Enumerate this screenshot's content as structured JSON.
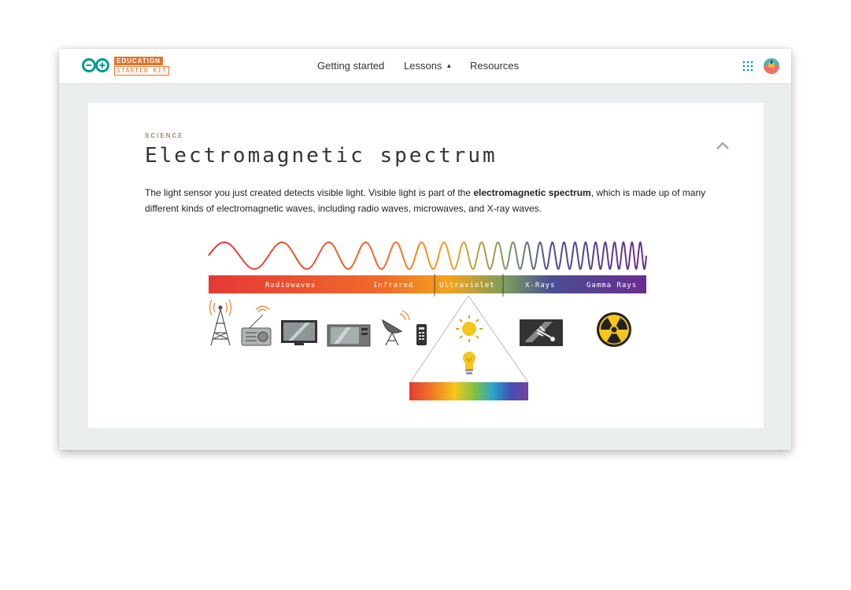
{
  "logo": {
    "tag_top": "EDUCATION",
    "tag_bottom": "STARTER KIT",
    "brand_color": "#e2732c",
    "mark_color": "#00979c"
  },
  "nav": {
    "items": [
      {
        "label": "Getting started"
      },
      {
        "label": "Lessons",
        "caret": "▲"
      },
      {
        "label": "Resources"
      }
    ]
  },
  "icons": {
    "apps": "grid-icon",
    "user": "avatar",
    "collapse": "chevron-up-icon"
  },
  "lesson": {
    "category": "SCIENCE",
    "title": "Electromagnetic spectrum",
    "body_before": "The light sensor you just created detects visible light. Visible light is part of the ",
    "body_bold": "electromagnetic spectrum",
    "body_after": ", which is made up of many different kinds of electromagnetic waves, including radio waves, microwaves, and X-ray waves."
  },
  "spectrum": {
    "bands": [
      "Radiowaves",
      "Infrared",
      "Ultraviolet",
      "X-Rays",
      "Gamma Rays"
    ],
    "devices": [
      "radio-tower-icon",
      "radio-icon",
      "television-icon",
      "microwave-icon",
      "satellite-dish-icon",
      "remote-control-icon",
      "sun-icon",
      "light-bulb-icon",
      "x-ray-icon",
      "radiation-icon"
    ],
    "colors": [
      "#e53935",
      "#ef7d22",
      "#f6c61b",
      "#7dc243",
      "#2ba5c9",
      "#3f51b5",
      "#7b3fa0"
    ]
  }
}
